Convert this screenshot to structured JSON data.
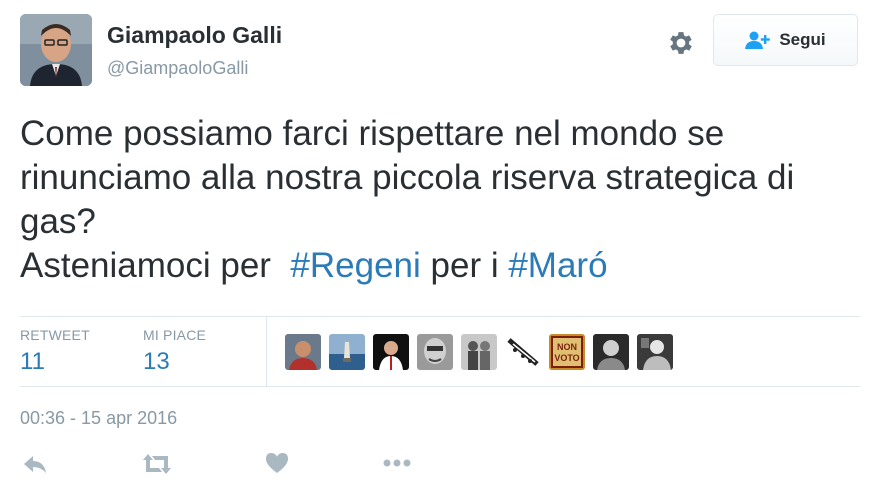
{
  "user": {
    "display_name": "Giampaolo Galli",
    "handle": "@GiampaoloGalli"
  },
  "follow_button": {
    "label": "Segui"
  },
  "tweet": {
    "line1": "Come possiamo farci rispettare nel mondo se rinunciamo alla nostra piccola riserva strategica di gas?",
    "line2_prefix": "Asteniamoci per  ",
    "hashtag1": "#Regeni",
    "line2_mid": " per i ",
    "hashtag2": "#Maró"
  },
  "stats": {
    "retweet_label": "RETWEET",
    "retweet_count": "11",
    "likes_label": "MI PIACE",
    "likes_count": "13"
  },
  "timestamp": "00:36 - 15 apr 2016",
  "liker_sign_text": "NON VOTO",
  "colors": {
    "link": "#2b7bb9",
    "muted": "#8899a6",
    "text": "#292f33",
    "divider": "#e1e8ed"
  },
  "icons": [
    "gear-icon",
    "follow-person-plus-icon",
    "reply-icon",
    "retweet-icon",
    "heart-icon",
    "more-icon"
  ]
}
